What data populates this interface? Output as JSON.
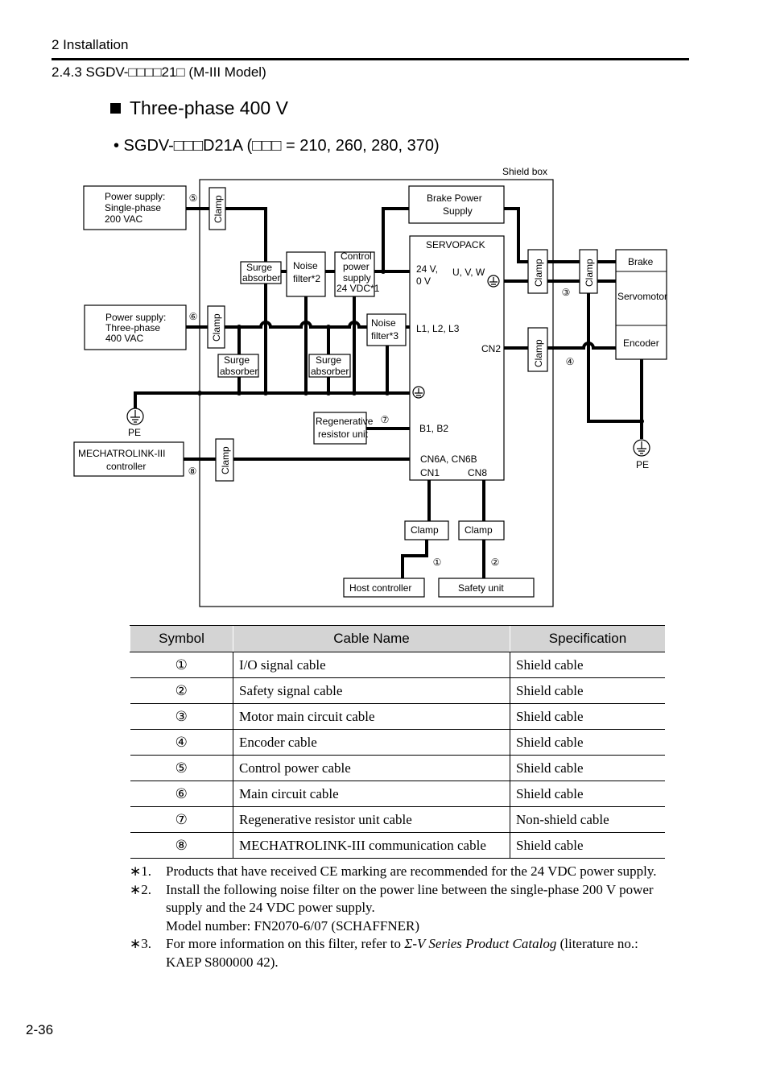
{
  "header": {
    "chapter": "2  Installation",
    "section": "2.4.3  SGDV-□□□□21□ (M-III Model)"
  },
  "heading": "Three-phase 400 V",
  "subheading": "•  SGDV-□□□D21A (□□□ = 210, 260, 280, 370)",
  "diagram": {
    "shield_box": "Shield box",
    "ps1": [
      "Power supply:",
      "Single-phase",
      "200 VAC"
    ],
    "ps3": [
      "Power supply:",
      "Three-phase",
      "400 VAC"
    ],
    "clamp": "Clamp",
    "surge": [
      "Surge",
      "absorber"
    ],
    "noise2": [
      "Noise",
      "filter*2"
    ],
    "ctrl_ps": [
      "Control",
      "power",
      "supply",
      "24 VDC*1"
    ],
    "noise3": [
      "Noise",
      "filter*3"
    ],
    "brake_ps": [
      "Brake Power",
      "Supply"
    ],
    "servopack": "SERVOPACK",
    "t24": [
      "24 V,",
      "0 V"
    ],
    "uvw": "U, V, W",
    "l123": "L1, L2, L3",
    "cn2": "CN2",
    "b12": "B1, B2",
    "cn6": "CN6A, CN6B",
    "cn1": "CN1",
    "cn8": "CN8",
    "regen": [
      "Regenerative",
      "resistor unit"
    ],
    "pe": "PE",
    "mlink": [
      "MECHATROLINK-III",
      "controller"
    ],
    "brake": "Brake",
    "servomotor": "Servomotor",
    "encoder": "Encoder",
    "host": "Host controller",
    "safety": "Safety unit",
    "nums": [
      "①",
      "②",
      "③",
      "④",
      "⑤",
      "⑥",
      "⑦",
      "⑧"
    ]
  },
  "table": {
    "headers": [
      "Symbol",
      "Cable Name",
      "Specification"
    ],
    "rows": [
      [
        "①",
        "I/O signal cable",
        "Shield cable"
      ],
      [
        "②",
        "Safety signal cable",
        "Shield cable"
      ],
      [
        "③",
        "Motor main circuit cable",
        "Shield cable"
      ],
      [
        "④",
        "Encoder cable",
        "Shield cable"
      ],
      [
        "⑤",
        "Control power cable",
        "Shield cable"
      ],
      [
        "⑥",
        "Main circuit cable",
        "Shield cable"
      ],
      [
        "⑦",
        "Regenerative resistor unit cable",
        "Non-shield cable"
      ],
      [
        "⑧",
        "MECHATROLINK-III communication cable",
        "Shield cable"
      ]
    ]
  },
  "notes": [
    {
      "mark": "∗1.",
      "lines": [
        "Products that have received CE marking are recommended for the 24 VDC power supply."
      ]
    },
    {
      "mark": "∗2.",
      "lines": [
        "Install the following noise filter on the power line between the single-phase 200 V power",
        "supply and the 24 VDC power supply.",
        "Model number: FN2070-6/07 (SCHAFFNER)"
      ]
    },
    {
      "mark": "∗3.",
      "pre": "For more information on this filter, refer to ",
      "italic": "Σ-V Series Product Catalog",
      "post": " (literature no.:",
      "line2": "KAEP S800000 42)."
    }
  ],
  "page_number": "2-36"
}
